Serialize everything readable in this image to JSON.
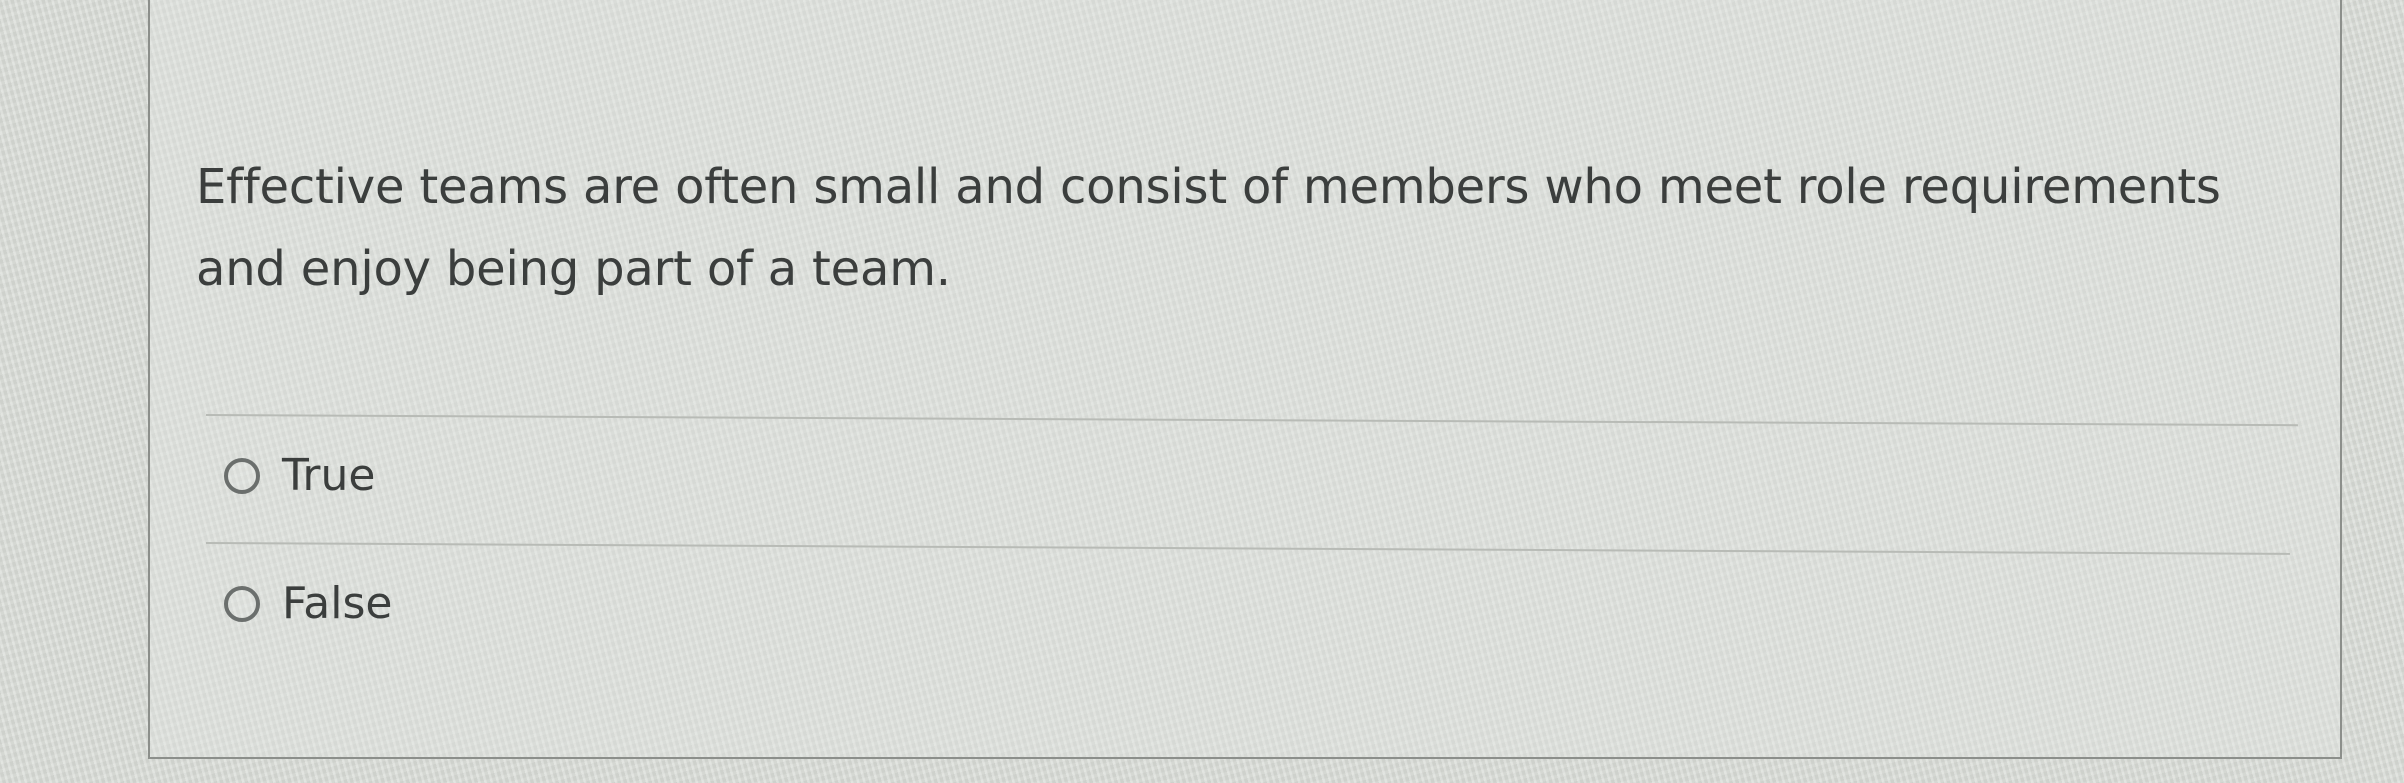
{
  "question": {
    "text": "Effective teams are often small and consist of members who meet role requirements and enjoy being part of a team."
  },
  "options": [
    {
      "label": "True",
      "icon": "radio-unselected-icon",
      "selected": false
    },
    {
      "label": "False",
      "icon": "radio-unselected-icon",
      "selected": false
    }
  ],
  "colors": {
    "background": "#d9dcd7",
    "border": "#8c8f8b",
    "text": "#3b3e3d",
    "radio": "#6b6f6d",
    "divider": "#b8bbb6"
  }
}
